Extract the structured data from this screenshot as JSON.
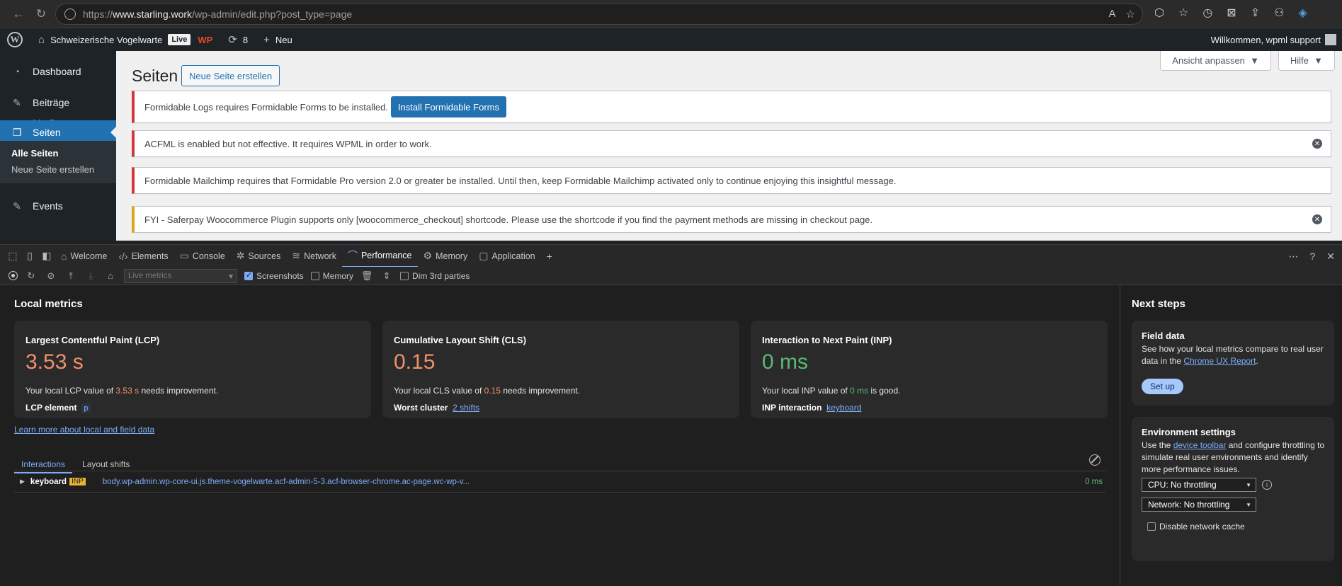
{
  "browser": {
    "url_prefix": "https://",
    "url_host": "www.starling.work",
    "url_path": "/wp-admin/edit.php?post_type=page"
  },
  "wpbar": {
    "site_name": "Schweizerische Vogelwarte",
    "live_label": "Live",
    "wpf_label": "WP",
    "updates_count": "8",
    "new_label": "Neu",
    "greeting": "Willkommen, wpml support"
  },
  "sidebar": {
    "items": [
      {
        "label": "Dashboard",
        "icon": "dashboard-icon"
      },
      {
        "label": "Beiträge",
        "icon": "pin-icon"
      },
      {
        "label": "Medien",
        "icon": "media-icon"
      },
      {
        "label": "Seiten",
        "icon": "pages-icon"
      },
      {
        "label": "Events",
        "icon": "pin-icon"
      }
    ],
    "sub": {
      "all_pages": "Alle Seiten",
      "new_page": "Neue Seite erstellen"
    }
  },
  "main": {
    "title": "Seiten",
    "add_new": "Neue Seite erstellen",
    "screen_options": "Ansicht anpassen",
    "help": "Hilfe",
    "notices": [
      {
        "text": "Formidable Logs requires Formidable Forms to be installed.",
        "button": "Install Formidable Forms"
      },
      {
        "text": "ACFML is enabled but not effective. It requires WPML in order to work."
      },
      {
        "text": "Formidable Mailchimp requires that Formidable Pro version 2.0 or greater be installed. Until then, keep Formidable Mailchimp activated only to continue enjoying this insightful message."
      },
      {
        "text": "FYI - Saferpay Woocommerce Plugin supports only [woocommerce_checkout] shortcode. Please use the shortcode if you find the payment methods are missing in checkout page."
      }
    ]
  },
  "devtools": {
    "tabs": [
      "Welcome",
      "Elements",
      "Console",
      "Sources",
      "Network",
      "Performance",
      "Memory",
      "Application"
    ],
    "active_tab": "Performance",
    "toolbar": {
      "select_placeholder": "Live metrics",
      "screenshots": "Screenshots",
      "memory": "Memory",
      "dim": "Dim 3rd parties"
    },
    "local_metrics_title": "Local metrics",
    "lcp": {
      "title": "Largest Contentful Paint (LCP)",
      "value": "3.53 s",
      "desc_pre": "Your local LCP value of ",
      "desc_val": "3.53 s",
      "desc_post": " needs improvement.",
      "extra_label": "LCP element",
      "extra_val": "p"
    },
    "cls": {
      "title": "Cumulative Layout Shift (CLS)",
      "value": "0.15",
      "desc_pre": "Your local CLS value of ",
      "desc_val": "0.15",
      "desc_post": " needs improvement.",
      "extra_label": "Worst cluster",
      "extra_val": "2 shifts"
    },
    "inp": {
      "title": "Interaction to Next Paint (INP)",
      "value": "0 ms",
      "desc_pre": "Your local INP value of ",
      "desc_val": "0 ms",
      "desc_post": " is good.",
      "extra_label": "INP interaction",
      "extra_val": "keyboard"
    },
    "learn_more": "Learn more about local and field data",
    "subtabs": [
      "Interactions",
      "Layout shifts"
    ],
    "interaction": {
      "type": "keyboard",
      "badge": "INP",
      "element": "body.wp-admin.wp-core-ui.js.theme-vogelwarte.acf-admin-5-3.acf-browser-chrome.ac-page.wc-wp-v...",
      "duration": "0 ms"
    },
    "next_steps": {
      "title": "Next steps",
      "field_title": "Field data",
      "field_pre": "See how your local metrics compare to real user data in the ",
      "field_link": "Chrome UX Report",
      "field_post": ".",
      "setup": "Set up",
      "env_title": "Environment settings",
      "env_pre": "Use the ",
      "env_link": "device toolbar",
      "env_post": " and configure throttling to simulate real user environments and identify more performance issues.",
      "cpu": "CPU: No throttling",
      "network": "Network: No throttling",
      "disable_cache": "Disable network cache"
    }
  }
}
